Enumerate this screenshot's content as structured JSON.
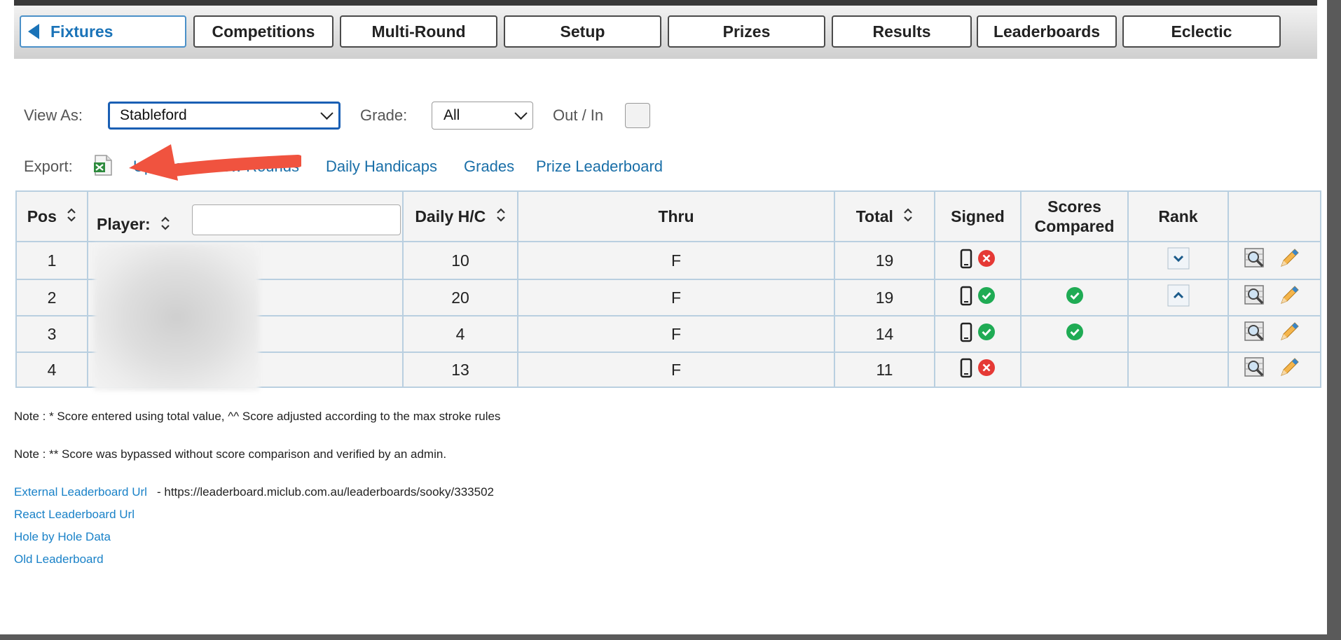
{
  "nav": {
    "tabs": [
      {
        "label": "Fixtures",
        "active": true
      },
      {
        "label": "Competitions"
      },
      {
        "label": "Multi-Round"
      },
      {
        "label": "Setup"
      },
      {
        "label": "Prizes"
      },
      {
        "label": "Results"
      },
      {
        "label": "Leaderboards"
      },
      {
        "label": "Eclectic"
      }
    ]
  },
  "filters": {
    "view_as_label": "View As:",
    "view_as_value": "Stableford",
    "grade_label": "Grade:",
    "grade_value": "All",
    "outin_label": "Out / In",
    "outin_checked": false
  },
  "export": {
    "label": "Export:",
    "icon": "excel-icon",
    "links": [
      "Update",
      "Show Rounds",
      "Daily Handicaps",
      "Grades",
      "Prize Leaderboard"
    ]
  },
  "table": {
    "headers": {
      "pos": "Pos",
      "player": "Player:",
      "daily_hc": "Daily H/C",
      "thru": "Thru",
      "total": "Total",
      "signed": "Signed",
      "scores_compared_line1": "Scores",
      "scores_compared_line2": "Compared",
      "rank": "Rank"
    },
    "player_filter_value": "",
    "rows": [
      {
        "pos": "1",
        "daily_hc": "10",
        "thru": "F",
        "total": "19",
        "signed": "no",
        "scores_compared": "",
        "rank": "down"
      },
      {
        "pos": "2",
        "daily_hc": "20",
        "thru": "F",
        "total": "19",
        "signed": "yes",
        "scores_compared": "yes",
        "rank": "up"
      },
      {
        "pos": "3",
        "daily_hc": "4",
        "thru": "F",
        "total": "14",
        "signed": "yes",
        "scores_compared": "yes",
        "rank": ""
      },
      {
        "pos": "4",
        "daily_hc": "13",
        "thru": "F",
        "total": "11",
        "signed": "no",
        "scores_compared": "",
        "rank": ""
      }
    ]
  },
  "notes": {
    "note1": "Note : * Score entered using total value, ^^ Score adjusted according to the max stroke rules",
    "note2": "Note : ** Score was bypassed without score comparison and verified by an admin."
  },
  "footer": {
    "external_label": "External Leaderboard Url",
    "external_url": " - https://leaderboard.miclub.com.au/leaderboards/sooky/333502",
    "react_label": "React Leaderboard Url",
    "hole_label": "Hole by Hole Data",
    "old_label": "Old Leaderboard"
  },
  "colors": {
    "accent": "#1a73b8",
    "link": "#1a6fa8",
    "success": "#1fab54",
    "danger": "#e53935",
    "arrow": "#f0533f"
  }
}
